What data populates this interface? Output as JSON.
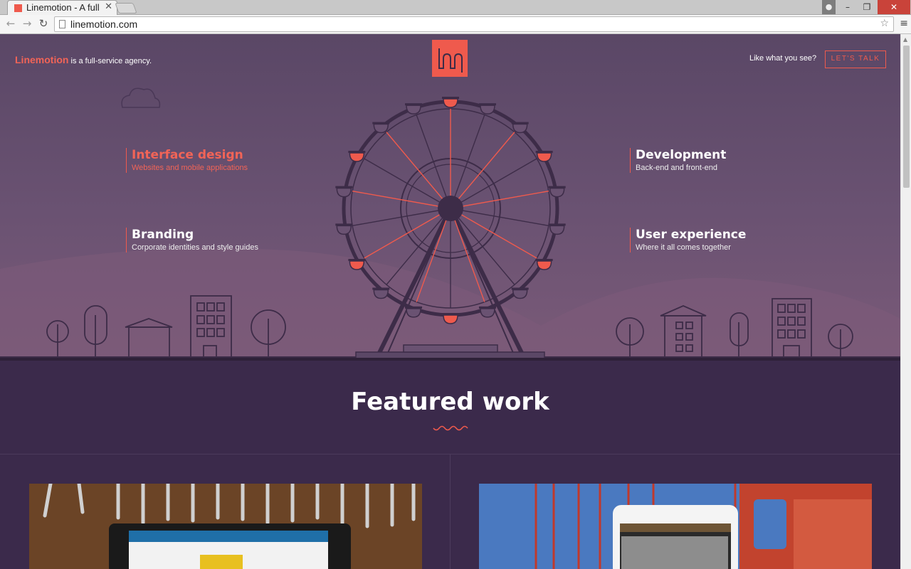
{
  "browser": {
    "tab_title": "Linemotion - A full",
    "tab_close": "✕",
    "url": "linemotion.com",
    "window_buttons": {
      "minimize": "–",
      "restore": "❐",
      "close": "✕"
    }
  },
  "site": {
    "brand_name": "Linemotion",
    "brand_tagline": "is a full-service agency.",
    "cta_text": "Like what you see?",
    "cta_button": "LET'S TALK",
    "services": [
      {
        "title": "Interface design",
        "subtitle": "Websites and mobile applications"
      },
      {
        "title": "Development",
        "subtitle": "Back-end and front-end"
      },
      {
        "title": "Branding",
        "subtitle": "Corporate identities and style guides"
      },
      {
        "title": "User experience",
        "subtitle": "Where it all comes together"
      }
    ],
    "featured_title": "Featured work"
  },
  "colors": {
    "accent": "#ef5a4d",
    "hero_top": "#5a4766",
    "section_bg": "#3b2a4b",
    "line": "#3d2c48"
  }
}
